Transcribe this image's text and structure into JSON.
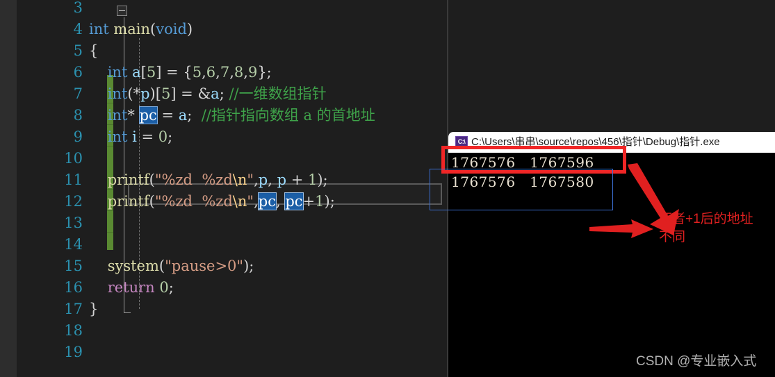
{
  "editor": {
    "gutter_start_line": 3,
    "lines": [
      {
        "num": "3",
        "indent": 0,
        "tokens": []
      },
      {
        "num": "4",
        "indent": 0,
        "tokens": [
          {
            "t": "int ",
            "c": "kw"
          },
          {
            "t": "main",
            "c": "fn"
          },
          {
            "t": "(",
            "c": "punc"
          },
          {
            "t": "void",
            "c": "kw"
          },
          {
            "t": ")",
            "c": "punc"
          }
        ]
      },
      {
        "num": "5",
        "indent": 0,
        "tokens": [
          {
            "t": "{",
            "c": "brk"
          }
        ]
      },
      {
        "num": "6",
        "indent": 0,
        "tokens": [
          {
            "t": "    ",
            "c": "punc"
          },
          {
            "t": "int",
            "c": "kw"
          },
          {
            "t": " ",
            "c": "punc"
          },
          {
            "t": "a",
            "c": "var"
          },
          {
            "t": "[",
            "c": "brk"
          },
          {
            "t": "5",
            "c": "num"
          },
          {
            "t": "] = {",
            "c": "brk"
          },
          {
            "t": "5",
            "c": "num"
          },
          {
            "t": ",",
            "c": "punc"
          },
          {
            "t": "6",
            "c": "num"
          },
          {
            "t": ",",
            "c": "punc"
          },
          {
            "t": "7",
            "c": "num"
          },
          {
            "t": ",",
            "c": "punc"
          },
          {
            "t": "8",
            "c": "num"
          },
          {
            "t": ",",
            "c": "punc"
          },
          {
            "t": "9",
            "c": "num"
          },
          {
            "t": "};",
            "c": "brk"
          }
        ]
      },
      {
        "num": "7",
        "indent": 0,
        "tokens": [
          {
            "t": "    ",
            "c": "punc"
          },
          {
            "t": "int",
            "c": "kw"
          },
          {
            "t": "(*",
            "c": "brk"
          },
          {
            "t": "p",
            "c": "var"
          },
          {
            "t": ")[",
            "c": "brk"
          },
          {
            "t": "5",
            "c": "num"
          },
          {
            "t": "] = &",
            "c": "brk"
          },
          {
            "t": "a",
            "c": "var"
          },
          {
            "t": "; ",
            "c": "punc"
          },
          {
            "t": "//一维数组指针",
            "c": "com"
          }
        ]
      },
      {
        "num": "8",
        "indent": 0,
        "tokens": [
          {
            "t": "    ",
            "c": "punc"
          },
          {
            "t": "int",
            "c": "kw"
          },
          {
            "t": "* ",
            "c": "brk"
          },
          {
            "t": "pc",
            "c": "sel"
          },
          {
            "t": " = ",
            "c": "brk"
          },
          {
            "t": "a",
            "c": "var"
          },
          {
            "t": ";  ",
            "c": "punc"
          },
          {
            "t": "//指针指向数组 a 的首地址",
            "c": "com"
          }
        ]
      },
      {
        "num": "9",
        "indent": 0,
        "tokens": [
          {
            "t": "    ",
            "c": "punc"
          },
          {
            "t": "int",
            "c": "kw"
          },
          {
            "t": " ",
            "c": "punc"
          },
          {
            "t": "i",
            "c": "var"
          },
          {
            "t": " = ",
            "c": "brk"
          },
          {
            "t": "0",
            "c": "num"
          },
          {
            "t": ";",
            "c": "punc"
          }
        ]
      },
      {
        "num": "10",
        "indent": 0,
        "tokens": []
      },
      {
        "num": "11",
        "indent": 0,
        "tokens": [
          {
            "t": "    ",
            "c": "punc"
          },
          {
            "t": "printf",
            "c": "fn"
          },
          {
            "t": "(",
            "c": "punc"
          },
          {
            "t": "\"%zd  %zd",
            "c": "str"
          },
          {
            "t": "\\n",
            "c": "esc"
          },
          {
            "t": "\"",
            "c": "str"
          },
          {
            "t": ",",
            "c": "punc"
          },
          {
            "t": "p",
            "c": "var"
          },
          {
            "t": ", ",
            "c": "punc"
          },
          {
            "t": "p",
            "c": "var"
          },
          {
            "t": " + ",
            "c": "brk"
          },
          {
            "t": "1",
            "c": "num"
          },
          {
            "t": ");",
            "c": "punc"
          }
        ]
      },
      {
        "num": "12",
        "indent": 0,
        "tokens": [
          {
            "t": "    ",
            "c": "punc"
          },
          {
            "t": "printf",
            "c": "fn"
          },
          {
            "t": "(",
            "c": "punc"
          },
          {
            "t": "\"%zd  %zd",
            "c": "str"
          },
          {
            "t": "\\n",
            "c": "esc"
          },
          {
            "t": "\"",
            "c": "str"
          },
          {
            "t": ",",
            "c": "punc"
          },
          {
            "t": "pc",
            "c": "sel2"
          },
          {
            "t": ", ",
            "c": "punc"
          },
          {
            "t": "pc",
            "c": "sel2"
          },
          {
            "t": "+",
            "c": "brk"
          },
          {
            "t": "1",
            "c": "num"
          },
          {
            "t": ");",
            "c": "punc"
          }
        ]
      },
      {
        "num": "13",
        "indent": 0,
        "tokens": []
      },
      {
        "num": "14",
        "indent": 0,
        "tokens": []
      },
      {
        "num": "15",
        "indent": 0,
        "tokens": [
          {
            "t": "    ",
            "c": "punc"
          },
          {
            "t": "system",
            "c": "fn"
          },
          {
            "t": "(",
            "c": "punc"
          },
          {
            "t": "\"pause>0\"",
            "c": "str"
          },
          {
            "t": ");",
            "c": "punc"
          }
        ]
      },
      {
        "num": "16",
        "indent": 0,
        "tokens": [
          {
            "t": "    ",
            "c": "punc"
          },
          {
            "t": "return",
            "c": "ctl"
          },
          {
            "t": " ",
            "c": "punc"
          },
          {
            "t": "0",
            "c": "num"
          },
          {
            "t": ";",
            "c": "punc"
          }
        ]
      },
      {
        "num": "17",
        "indent": 0,
        "tokens": [
          {
            "t": "}",
            "c": "brk"
          }
        ]
      },
      {
        "num": "18",
        "indent": 0,
        "tokens": []
      },
      {
        "num": "19",
        "indent": 0,
        "tokens": []
      }
    ],
    "fold_icon": "collapse-minus-icon",
    "change_bar_color": "#5a8a32",
    "selected_token": "pc",
    "current_line_number": "12"
  },
  "console": {
    "app_icon_label": "C:\\",
    "title": "C:\\Users\\串串\\source\\repos\\456\\指针\\Debug\\指针.exe",
    "output_lines": [
      "1767576   1767596",
      "1767576   1767580"
    ]
  },
  "annotations": {
    "red_rect_color": "#f02626",
    "blue_rect_color": "#3b6fd4",
    "note_text": "两者+1后的地址\n不同",
    "arrow_color": "#e02020"
  },
  "watermark": {
    "text": "CSDN @专业嵌入式"
  }
}
